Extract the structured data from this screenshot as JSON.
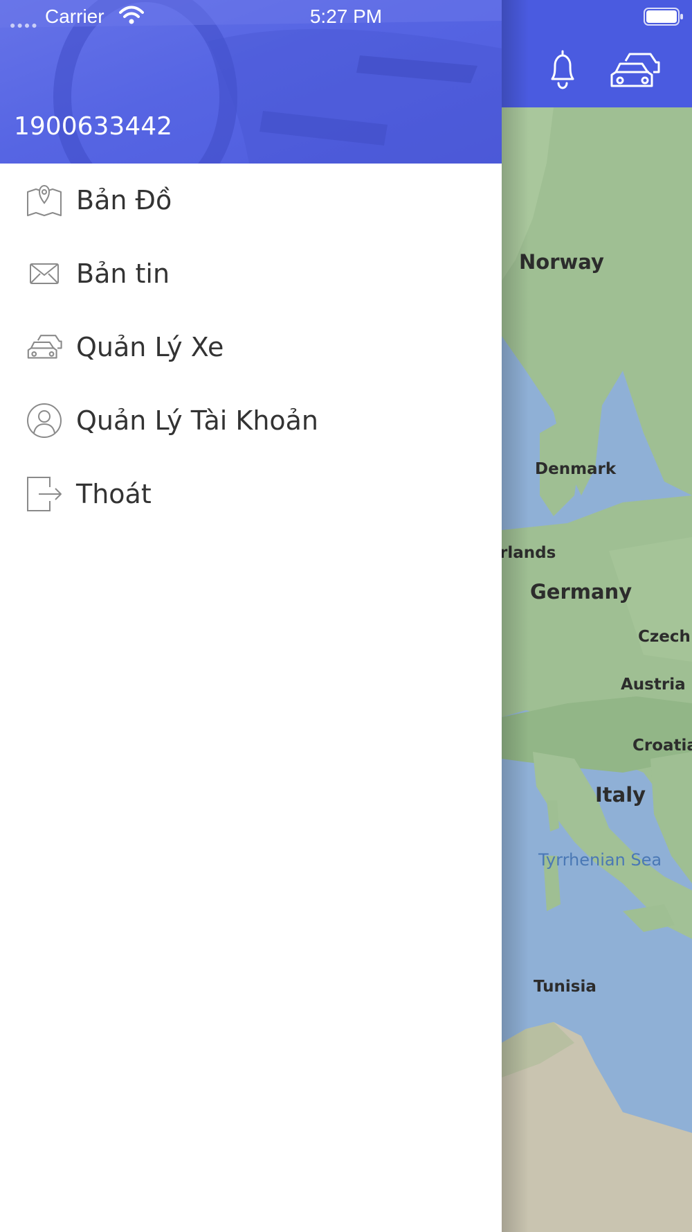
{
  "status_bar": {
    "carrier": "Carrier",
    "time": "5:27 PM",
    "icons": [
      "signal-dots-icon",
      "wifi-icon",
      "battery-icon"
    ]
  },
  "drawer": {
    "phone": "1900633442",
    "menu": [
      {
        "label": "Bản Đồ",
        "icon": "map-pin-icon"
      },
      {
        "label": "Bản tin",
        "icon": "mail-icon"
      },
      {
        "label": "Quản Lý Xe",
        "icon": "cars-icon"
      },
      {
        "label": "Quản Lý Tài Khoản",
        "icon": "user-circle-icon"
      },
      {
        "label": "Thoát",
        "icon": "logout-icon"
      }
    ]
  },
  "map_screen": {
    "topbar_icons": [
      "bell-icon",
      "cars-icon"
    ],
    "map_labels": {
      "norway": "Norway",
      "denmark": "Denmark",
      "netherlands": "rlands",
      "germany": "Germany",
      "czech": "Czech",
      "austria": "Austria",
      "croatia": "Croatia",
      "italy": "Italy",
      "tyrrhenian": "Tyrrhenian Sea",
      "tunisia": "Tunisia"
    }
  },
  "colors": {
    "topbar": "#4a5be0",
    "header": "#5665e3",
    "water": "#8fb0d6",
    "land": "#9fbf93",
    "menu_text": "#333333"
  }
}
